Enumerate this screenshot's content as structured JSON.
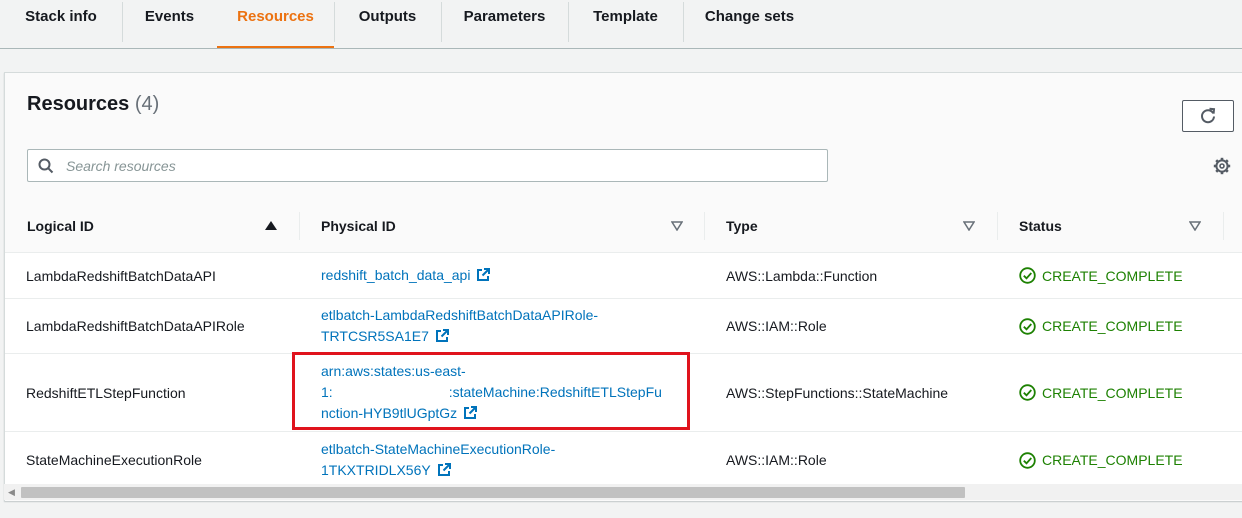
{
  "tabs": [
    {
      "label": "Stack info"
    },
    {
      "label": "Events"
    },
    {
      "label": "Resources"
    },
    {
      "label": "Outputs"
    },
    {
      "label": "Parameters"
    },
    {
      "label": "Template"
    },
    {
      "label": "Change sets"
    }
  ],
  "resources": {
    "title": "Resources",
    "count": "(4)",
    "search_placeholder": "Search resources"
  },
  "table": {
    "headers": {
      "logical_id": "Logical ID",
      "physical_id": "Physical ID",
      "type": "Type",
      "status": "Status"
    },
    "rows": [
      {
        "logical_id": "LambdaRedshiftBatchDataAPI",
        "physical_lines": [
          "redshift_batch_data_api"
        ],
        "type": "AWS::Lambda::Function",
        "status": "CREATE_COMPLETE"
      },
      {
        "logical_id": "LambdaRedshiftBatchDataAPIRole",
        "physical_lines": [
          "etlbatch-LambdaRedshiftBatchDataAPIRole-",
          "TRTCSR5SA1E7"
        ],
        "type": "AWS::IAM::Role",
        "status": "CREATE_COMPLETE"
      },
      {
        "logical_id": "RedshiftETLStepFunction",
        "physical_lines": [
          "arn:aws:states:us-east-",
          "1:",
          ":stateMachine:RedshiftETLStepFu",
          "nction-HYB9tlUGptGz"
        ],
        "type": "AWS::StepFunctions::StateMachine",
        "status": "CREATE_COMPLETE"
      },
      {
        "logical_id": "StateMachineExecutionRole",
        "physical_lines": [
          "etlbatch-StateMachineExecutionRole-",
          "1TKXTRIDLX56Y"
        ],
        "type": "AWS::IAM::Role",
        "status": "CREATE_COMPLETE"
      }
    ]
  },
  "colors": {
    "accent": "#ec7211",
    "link": "#0073bb",
    "success": "#1d8102",
    "highlight": "#e0131d"
  },
  "icons": {
    "refresh": "refresh-icon",
    "search": "search-icon",
    "settings": "gear-icon",
    "external": "external-link-icon",
    "status_ok": "check-circle-icon"
  }
}
